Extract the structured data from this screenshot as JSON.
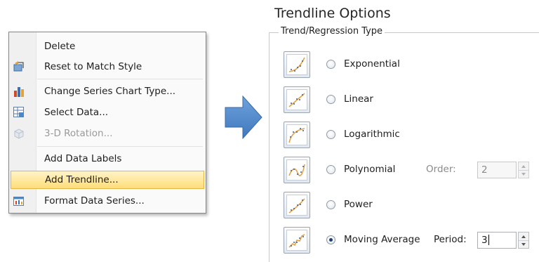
{
  "context_menu": {
    "items": [
      {
        "label": "Delete",
        "icon": "",
        "enabled": true
      },
      {
        "label": "Reset to Match Style",
        "icon": "reset-style-icon",
        "enabled": true
      },
      {
        "label": "Change Series Chart Type...",
        "icon": "bar-chart-icon",
        "enabled": true
      },
      {
        "label": "Select Data...",
        "icon": "select-data-icon",
        "enabled": true
      },
      {
        "label": "3-D Rotation...",
        "icon": "3d-rotation-icon",
        "enabled": false
      },
      {
        "label": "Add Data Labels",
        "icon": "",
        "enabled": true
      },
      {
        "label": "Add Trendline...",
        "icon": "",
        "enabled": true,
        "highlighted": true
      },
      {
        "label": "Format Data Series...",
        "icon": "format-series-icon",
        "enabled": true
      }
    ]
  },
  "trendline_options": {
    "title": "Trendline Options",
    "group_label": "Trend/Regression Type",
    "selected": "Moving Average",
    "types": [
      {
        "label": "Exponential",
        "icon": "exponential-trend-icon"
      },
      {
        "label": "Linear",
        "icon": "linear-trend-icon"
      },
      {
        "label": "Logarithmic",
        "icon": "logarithmic-trend-icon"
      },
      {
        "label": "Polynomial",
        "icon": "polynomial-trend-icon"
      },
      {
        "label": "Power",
        "icon": "power-trend-icon"
      },
      {
        "label": "Moving Average",
        "icon": "moving-average-trend-icon"
      }
    ],
    "order": {
      "label": "Order:",
      "value": "2",
      "enabled": false
    },
    "period": {
      "label": "Period:",
      "value": "3",
      "enabled": true
    }
  },
  "colors": {
    "highlight": "#ffdd7a",
    "arrow": "#4a86c8",
    "trend_line": "#e3a24a",
    "radio_dot": "#1e3f6b"
  }
}
